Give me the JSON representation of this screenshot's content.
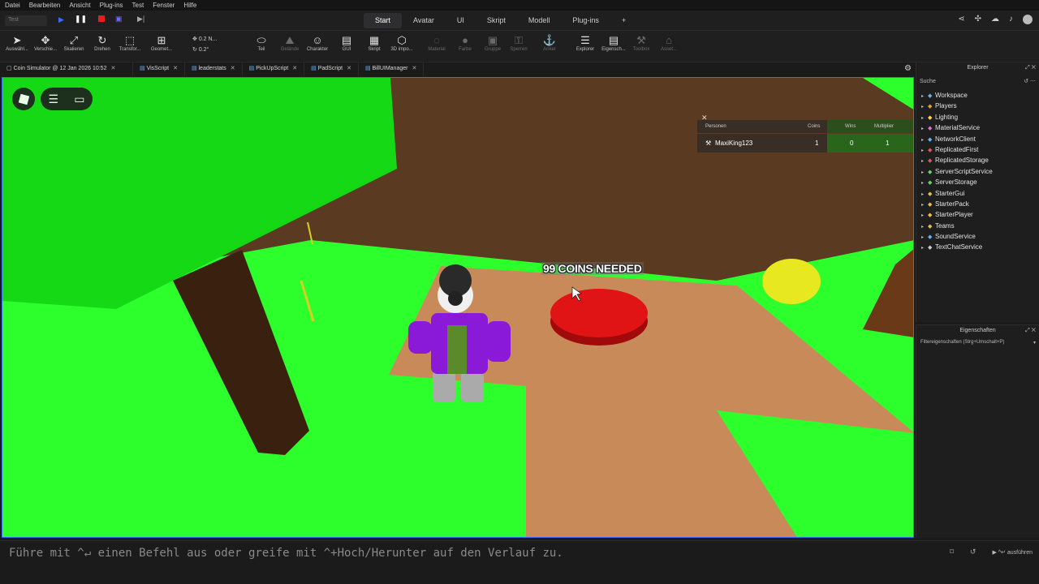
{
  "menubar": {
    "items": [
      "Datei",
      "Bearbeiten",
      "Ansicht",
      "Plug-ins",
      "Test",
      "Fenster",
      "Hilfe"
    ]
  },
  "topbar": {
    "run_mode": "Test",
    "tabs": [
      "Start",
      "Avatar",
      "UI",
      "Skript",
      "Modell",
      "Plug-ins"
    ],
    "active_tab": "Start"
  },
  "toolbar": {
    "tools": [
      {
        "label": "Auswähl...",
        "icon": "select-icon"
      },
      {
        "label": "Verschie...",
        "icon": "move-icon"
      },
      {
        "label": "Skalieren",
        "icon": "scale-icon"
      },
      {
        "label": "Drehen",
        "icon": "rotate-icon"
      },
      {
        "label": "Transfor...",
        "icon": "transform-icon"
      },
      {
        "label": "Geomet...",
        "icon": "geometry-icon"
      },
      {
        "label": "Teil",
        "icon": "part-icon"
      },
      {
        "label": "Gelände",
        "icon": "terrain-icon"
      },
      {
        "label": "Charakter",
        "icon": "character-icon"
      },
      {
        "label": "GUI",
        "icon": "gui-icon"
      },
      {
        "label": "Skript",
        "icon": "script-icon"
      },
      {
        "label": "3D impo...",
        "icon": "import-3d-icon"
      },
      {
        "label": "Material",
        "icon": "material-icon"
      },
      {
        "label": "Farbe",
        "icon": "color-icon"
      },
      {
        "label": "Gruppe",
        "icon": "group-icon"
      },
      {
        "label": "Sperren",
        "icon": "lock-icon"
      },
      {
        "label": "Anker",
        "icon": "anchor-icon"
      },
      {
        "label": "Explorer",
        "icon": "explorer-icon"
      },
      {
        "label": "Eigensch...",
        "icon": "properties-icon"
      },
      {
        "label": "Toolbox",
        "icon": "toolbox-icon"
      },
      {
        "label": "Asset...",
        "icon": "asset-icon"
      }
    ],
    "move_step": "0.2 N...",
    "rotate_step": "0.2°"
  },
  "doc_tabs": [
    "Coin Simulator @ 12 Jan 2026 10:52",
    "VisScript",
    "leaderstats",
    "PickUpScript",
    "PadScript",
    "BillUIManager"
  ],
  "viewport": {
    "billboard": "99 COINS NEEDED",
    "leaderboard": {
      "headers": [
        "Personen",
        "Coins",
        "Wins",
        "Multiplier"
      ],
      "rows": [
        {
          "name": "MaxiKing123",
          "coins": "1",
          "wins": "0",
          "multiplier": "1"
        }
      ]
    }
  },
  "explorer": {
    "title": "Explorer",
    "search_placeholder": "Suche",
    "items": [
      {
        "label": "Workspace",
        "icon": "workspace-icon",
        "color": "#5fb3ff"
      },
      {
        "label": "Players",
        "icon": "players-icon",
        "color": "#f0a030"
      },
      {
        "label": "Lighting",
        "icon": "lighting-icon",
        "color": "#ffd94a"
      },
      {
        "label": "MaterialService",
        "icon": "material-service-icon",
        "color": "#e06fd0"
      },
      {
        "label": "NetworkClient",
        "icon": "network-icon",
        "color": "#5fb3ff"
      },
      {
        "label": "ReplicatedFirst",
        "icon": "replicated-first-icon",
        "color": "#e05a5a"
      },
      {
        "label": "ReplicatedStorage",
        "icon": "replicated-storage-icon",
        "color": "#e05a5a"
      },
      {
        "label": "ServerScriptService",
        "icon": "server-script-icon",
        "color": "#6ad36a"
      },
      {
        "label": "ServerStorage",
        "icon": "server-storage-icon",
        "color": "#6ad36a"
      },
      {
        "label": "StarterGui",
        "icon": "starter-gui-icon",
        "color": "#f0c040"
      },
      {
        "label": "StarterPack",
        "icon": "starter-pack-icon",
        "color": "#f0c040"
      },
      {
        "label": "StarterPlayer",
        "icon": "starter-player-icon",
        "color": "#f0c040"
      },
      {
        "label": "Teams",
        "icon": "teams-icon",
        "color": "#f0c040"
      },
      {
        "label": "SoundService",
        "icon": "sound-icon",
        "color": "#5fb3ff"
      },
      {
        "label": "TextChatService",
        "icon": "text-chat-icon",
        "color": "#cccccc"
      }
    ]
  },
  "properties": {
    "title": "Eigenschaften",
    "filter_placeholder": "Filtereigenschaften (Strg+Umschalt+P)"
  },
  "command_bar": {
    "placeholder": "Führe mit ^↵ einen Befehl aus oder greife mit ^+Hoch/Herunter auf den Verlauf zu.",
    "run_label": "▶ ^↵ ausführen"
  },
  "colors": {
    "grass": "#2dff2d",
    "tree_canopy": "#15d915",
    "dirt": "#c98a5a",
    "wall": "#5a3a20",
    "red_pad": "#e01414",
    "coin": "#e8e820",
    "accent": "#3a6cff"
  }
}
